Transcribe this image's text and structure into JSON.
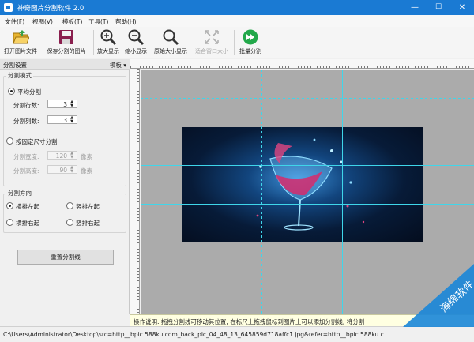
{
  "window": {
    "title": "神奇图片分割软件 2.0",
    "controls": {
      "minimize": "—",
      "maximize": "☐",
      "close": "✕"
    }
  },
  "menu": [
    "文件(F)",
    "视图(V)",
    "模板(T)",
    "工具(T)",
    "帮助(H)"
  ],
  "toolbar": {
    "open": "打开图片文件",
    "save": "保存分割的图片",
    "zoom_in": "放大显示",
    "zoom_out": "缩小显示",
    "actual_size": "原始大小显示",
    "fit_window": "适合窗口大小",
    "batch": "批量分割"
  },
  "panel": {
    "header": "分割设置",
    "template_menu": "模板 ▾",
    "split_mode": {
      "label": "分割模式",
      "equal": "平均分割",
      "rows_label": "分割行数:",
      "rows_value": "3",
      "cols_label": "分割列数:",
      "cols_value": "3",
      "fixed": "按固定尺寸分割",
      "width_label": "分割宽度:",
      "width_value": "120",
      "width_unit": "像素",
      "height_label": "分割高度:",
      "height_value": "90",
      "height_unit": "像素"
    },
    "direction": {
      "label": "分割方向",
      "h_left": "横排左起",
      "v_left": "竖排左起",
      "h_right": "横排右起",
      "v_right": "竖排右起"
    },
    "reset": "重置分割线"
  },
  "hint": "操作说明: 拖拽分割线可移动其位置; 在标尺上拖拽鼠标到图片上可以添加分割线; 将分割",
  "status_path": "C:\\Users\\Administrator\\Desktop\\src=http__bpic.588ku.com_back_pic_04_48_13_645859d718affc1.jpg&refer=http__bpic.588ku.c",
  "watermark": "海绵软件",
  "colors": {
    "titlebar": "#1a7ad3",
    "guide": "#3fd6ea",
    "canvas": "#ababab"
  }
}
